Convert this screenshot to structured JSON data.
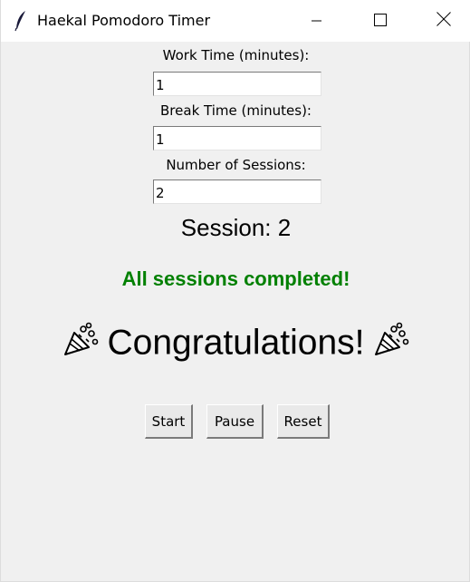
{
  "window": {
    "title": "Haekal Pomodoro Timer",
    "icons": {
      "app": "feather-icon",
      "minimize": "minimize-icon",
      "maximize": "maximize-icon",
      "close": "close-icon"
    }
  },
  "form": {
    "work_label": "Work Time (minutes):",
    "work_value": "1",
    "break_label": "Break Time (minutes):",
    "break_value": "1",
    "sessions_label": "Number of Sessions:",
    "sessions_value": "2"
  },
  "status": {
    "session_text": "Session: 2",
    "completed_text": "All sessions completed!",
    "completed_color": "#008000",
    "congrats_text": "Congratulations!",
    "congrats_icon": "party-popper-icon"
  },
  "buttons": {
    "start": "Start",
    "pause": "Pause",
    "reset": "Reset"
  }
}
